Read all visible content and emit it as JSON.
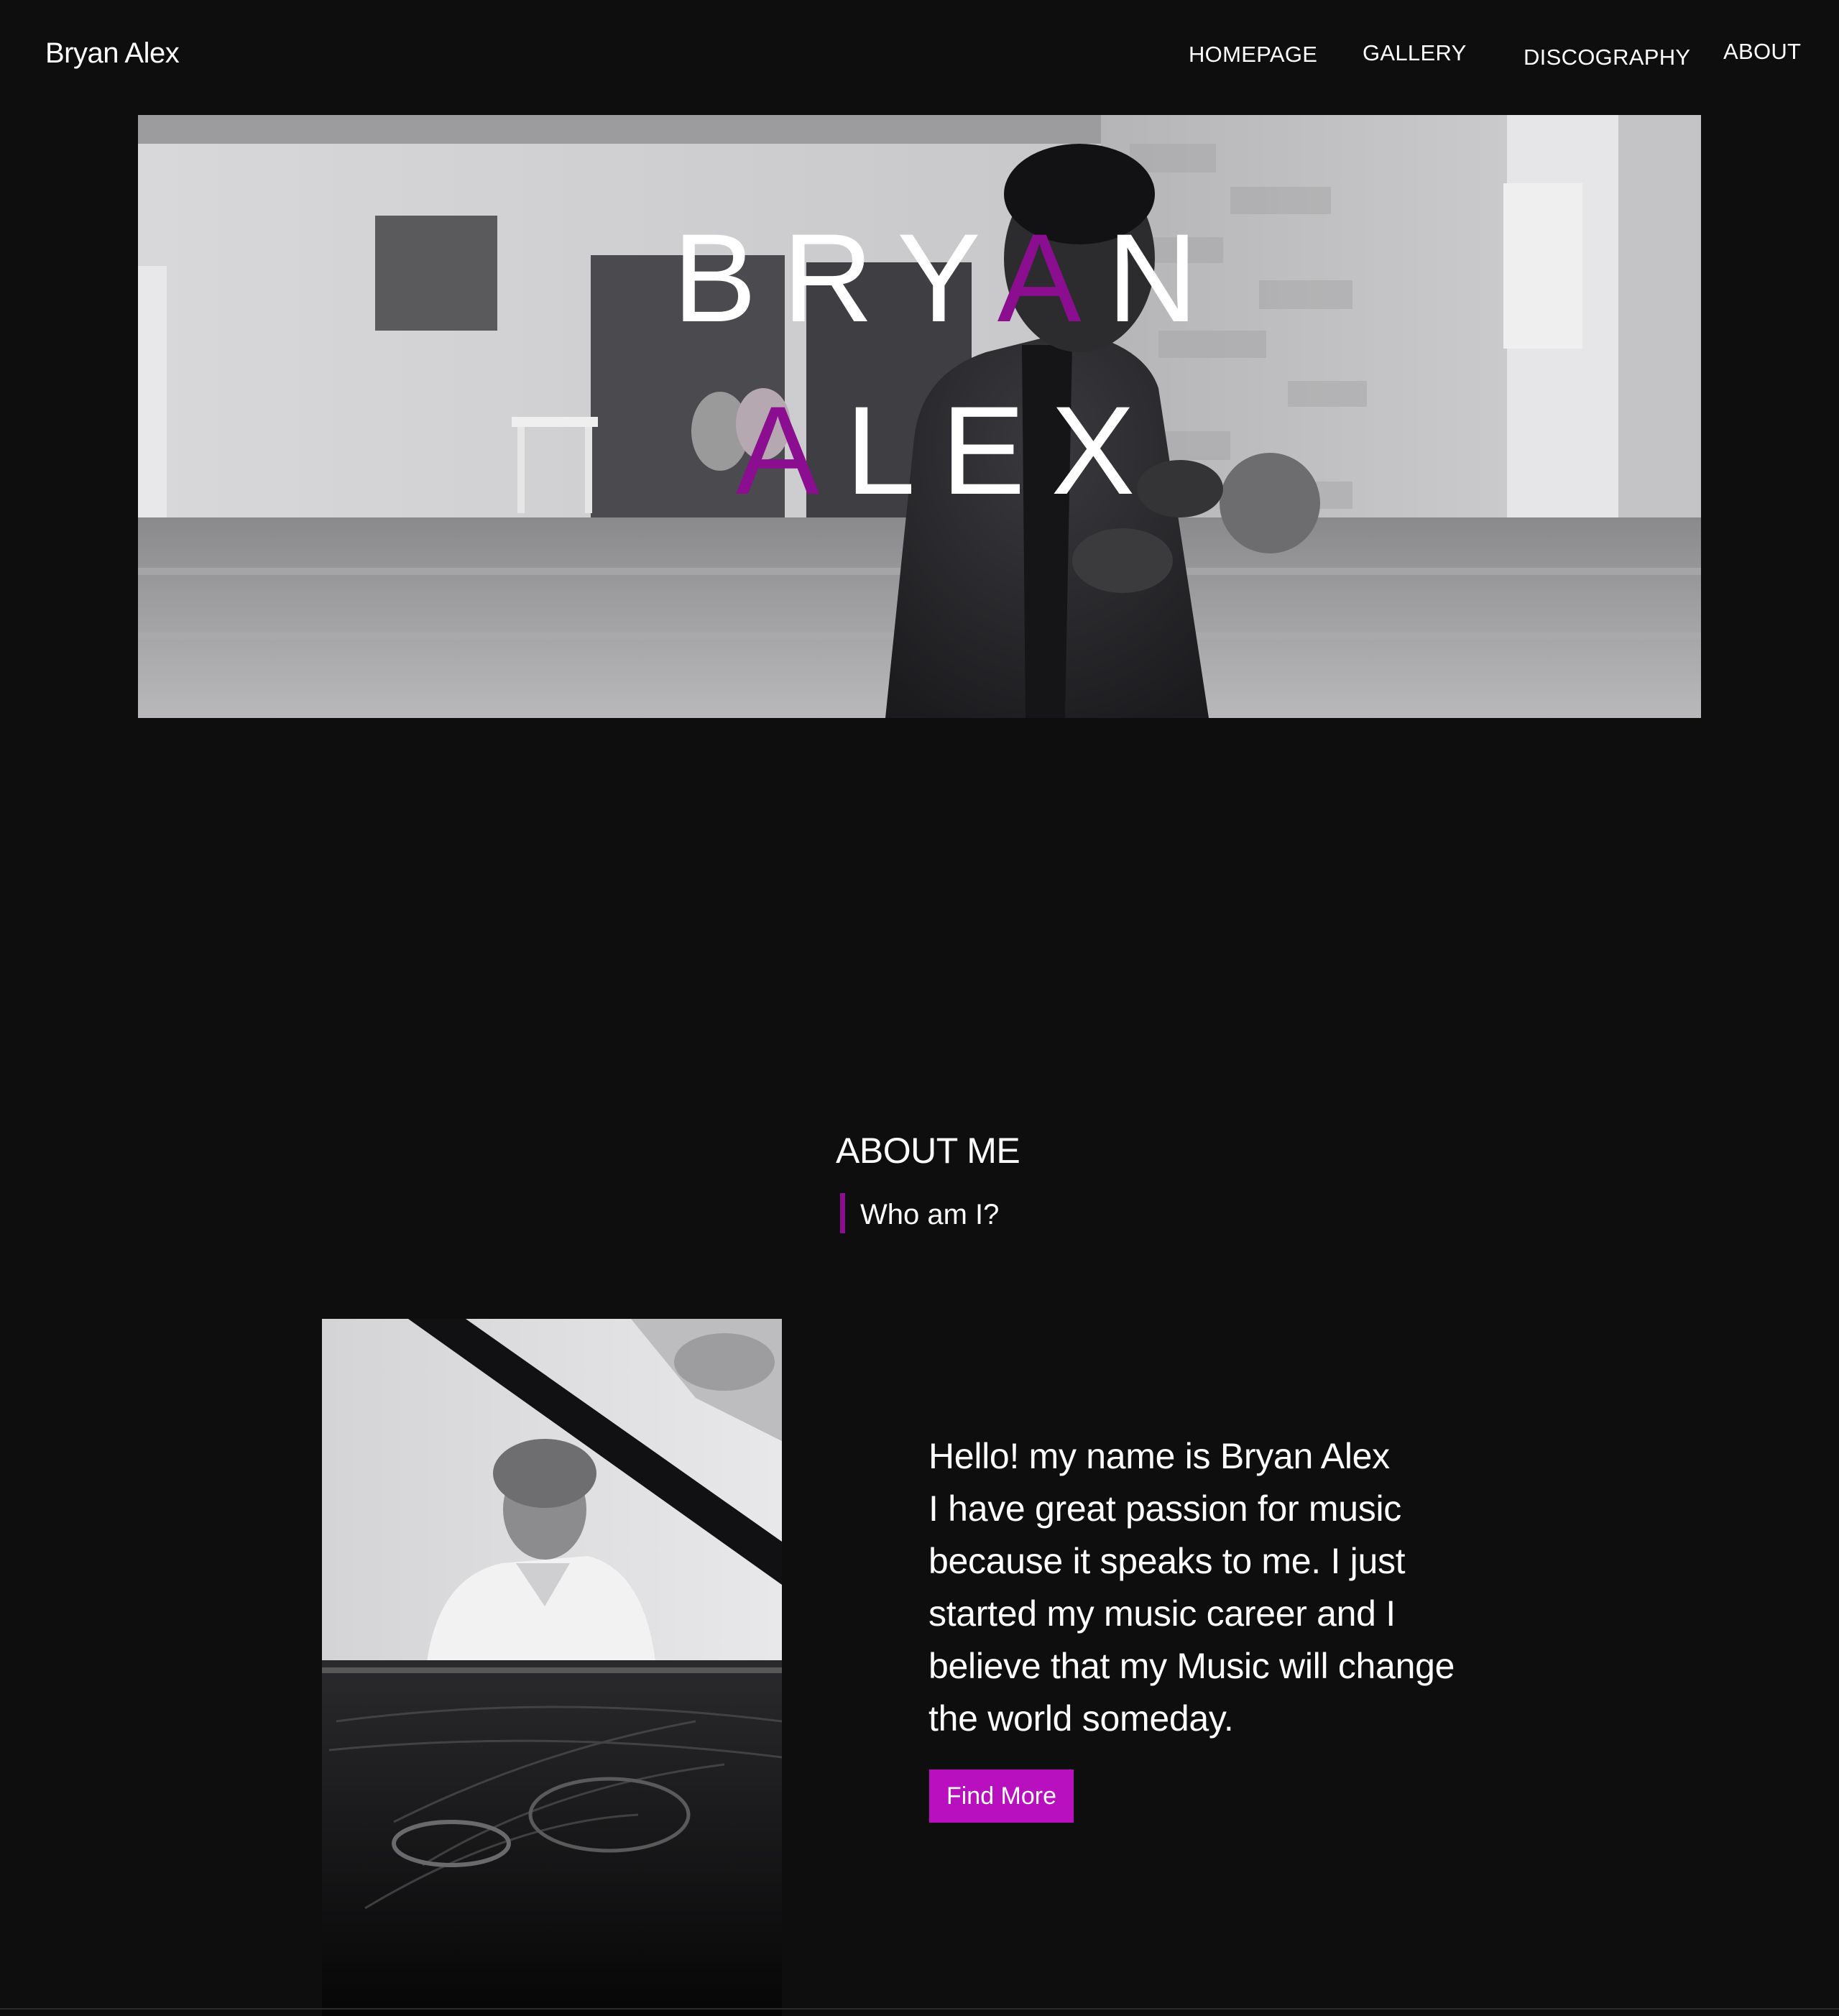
{
  "header": {
    "brand": "Bryan Alex",
    "nav": {
      "homepage": "HOMEPAGE",
      "gallery": "GALLERY",
      "discography": "DISCOGRAPHY",
      "about": "ABOUT"
    }
  },
  "hero": {
    "line1": {
      "part1": "BRY",
      "accent": "A",
      "part2": "N"
    },
    "line2": {
      "accent": "A",
      "part2": "LEX"
    }
  },
  "about": {
    "title": "ABOUT ME",
    "subtitle": "Who am I?",
    "lines": [
      "Hello! my name is Bryan Alex",
      "I have great passion for music",
      "because it speaks to me. I just",
      "started my music career and I",
      "believe that my Music will change",
      "the world someday."
    ],
    "button_label": "Find More"
  },
  "colors": {
    "background": "#0e0e0f",
    "accent": "#8a0e8f",
    "button": "#b80fbf",
    "text": "#ffffff"
  }
}
